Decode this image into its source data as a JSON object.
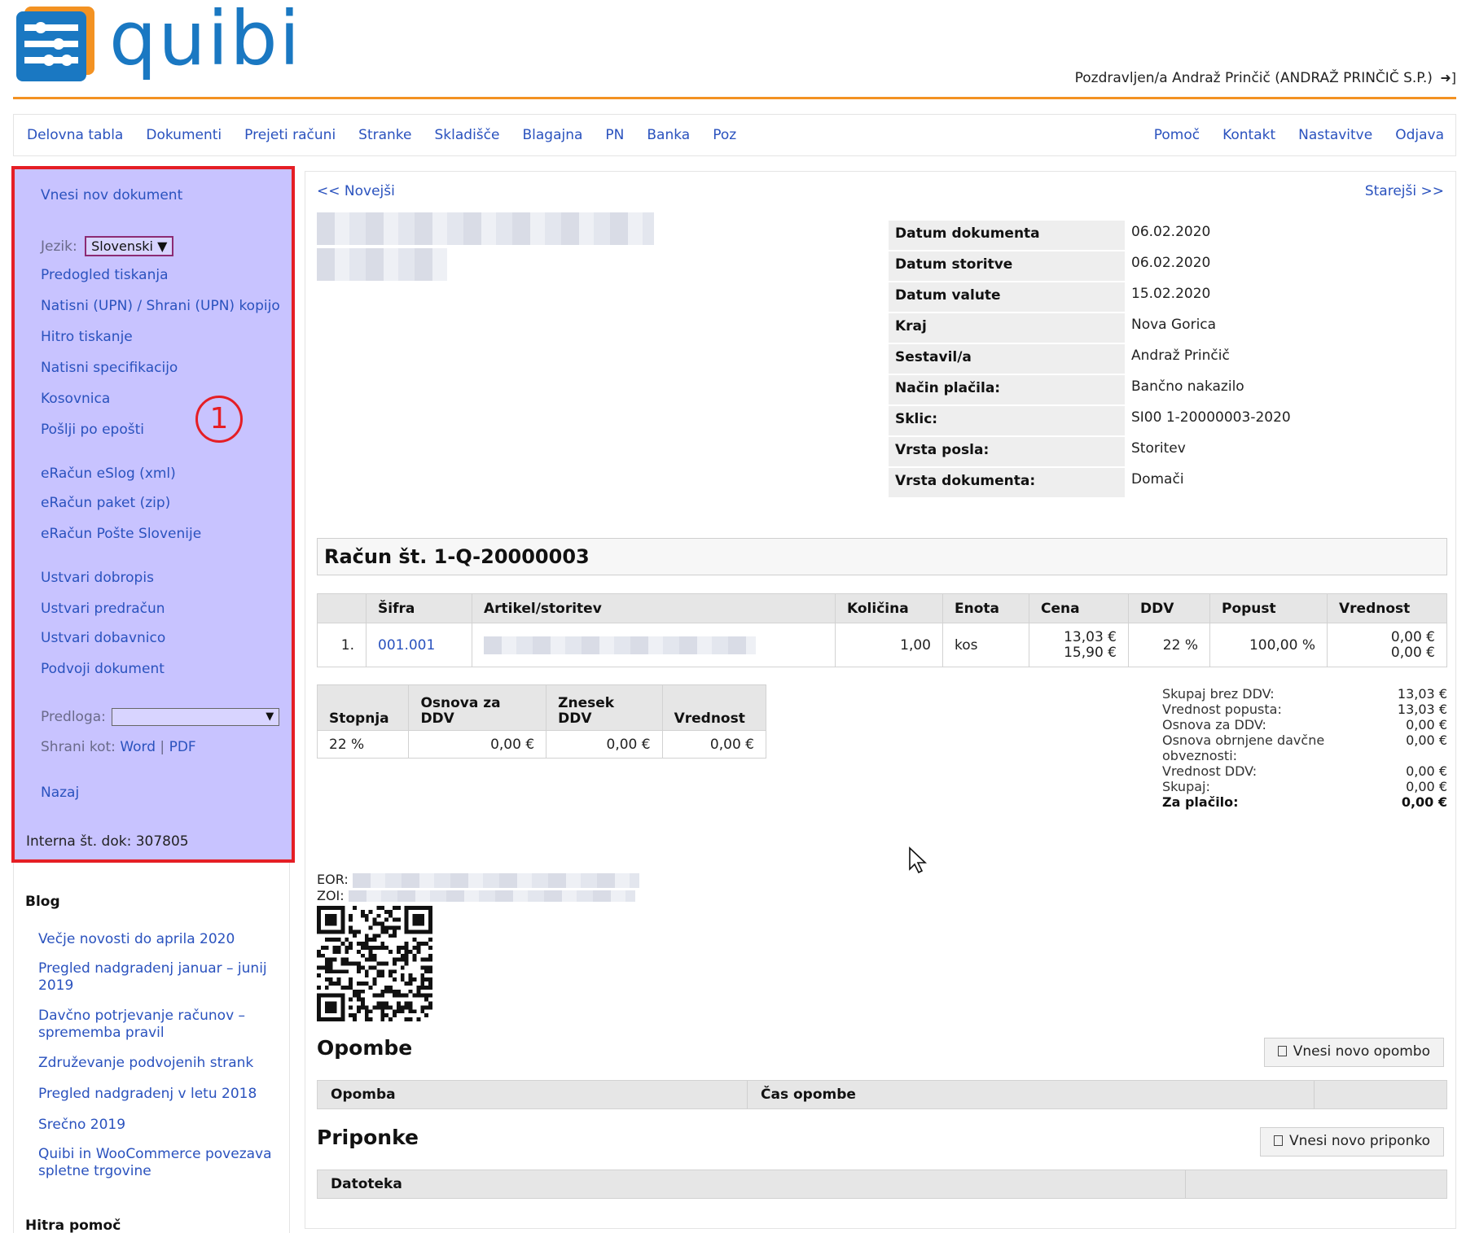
{
  "header": {
    "logo_text": "quibi",
    "greeting": "Pozdravljen/a Andraž Prinčič (ANDRAŽ PRINČIČ S.P.)",
    "logout_icon": "logout-icon"
  },
  "nav": {
    "left": [
      "Delovna tabla",
      "Dokumenti",
      "Prejeti računi",
      "Stranke",
      "Skladišče",
      "Blagajna",
      "PN",
      "Banka",
      "Poz"
    ],
    "right": [
      "Pomoč",
      "Kontakt",
      "Nastavitve",
      "Odjava"
    ]
  },
  "sidebar": {
    "new_document": "Vnesi nov dokument",
    "language_label": "Jezik:",
    "language_value": "Slovenski",
    "print_preview": "Predogled tiskanja",
    "print_upn": "Natisni (UPN) / Shrani (UPN) kopijo",
    "quick_print": "Hitro tiskanje",
    "print_spec": "Natisni specifikacijo",
    "kosovnica": "Kosovnica",
    "send_email": "Pošlji po epošti",
    "eracun_xml": "eRačun eSlog (xml)",
    "eracun_zip": "eRačun paket (zip)",
    "eracun_posta": "eRačun Pošte Slovenije",
    "create_credit": "Ustvari dobropis",
    "create_proforma": "Ustvari predračun",
    "create_delivery": "Ustvari dobavnico",
    "duplicate": "Podvoji dokument",
    "template_label": "Predloga:",
    "save_as_label": "Shrani kot:",
    "save_word": "Word",
    "save_sep": "|",
    "save_pdf": "PDF",
    "back": "Nazaj",
    "internal_no": "Interna št. dok: 307805",
    "badge": "1"
  },
  "blog": {
    "title": "Blog",
    "items": [
      "Večje novosti do aprila 2020",
      "Pregled nadgradenj januar – junij 2019",
      "Davčno potrjevanje računov – sprememba pravil",
      "Združevanje podvojenih strank",
      "Pregled nadgradenj v letu 2018",
      "Srečno 2019",
      "Quibi in WooCommerce povezava spletne trgovine"
    ],
    "help_title": "Hitra pomoč"
  },
  "main": {
    "newer": "<< Novejši",
    "older": "Starejši >>",
    "meta": [
      {
        "k": "Datum dokumenta",
        "v": "06.02.2020"
      },
      {
        "k": "Datum storitve",
        "v": "06.02.2020"
      },
      {
        "k": "Datum valute",
        "v": "15.02.2020"
      },
      {
        "k": "Kraj",
        "v": "Nova Gorica"
      },
      {
        "k": "Sestavil/a",
        "v": "Andraž Prinčič"
      },
      {
        "k": "Način plačila:",
        "v": "Bančno nakazilo"
      },
      {
        "k": "Sklic:",
        "v": "SI00 1-20000003-2020"
      },
      {
        "k": "Vrsta posla:",
        "v": "Storitev"
      },
      {
        "k": "Vrsta dokumenta:",
        "v": "Domači"
      }
    ],
    "doc_title": "Račun št. 1-Q-20000003",
    "items_headers": [
      "",
      "Šifra",
      "Artikel/storitev",
      "Količina",
      "Enota",
      "Cena",
      "DDV",
      "Popust",
      "Vrednost"
    ],
    "items_row": {
      "no": "1.",
      "code": "001.001",
      "qty": "1,00",
      "unit": "kos",
      "price1": "13,03 €",
      "price2": "15,90 €",
      "vat": "22 %",
      "discount": "100,00 %",
      "value1": "0,00 €",
      "value2": "0,00 €"
    },
    "vat_headers": [
      "Stopnja",
      "Osnova za DDV",
      "Znesek DDV",
      "Vrednost"
    ],
    "vat_row": [
      "22 %",
      "0,00 €",
      "0,00 €",
      "0,00 €"
    ],
    "totals": [
      {
        "label": "Skupaj brez DDV:",
        "value": "13,03 €"
      },
      {
        "label": "Vrednost popusta:",
        "value": "13,03 €"
      },
      {
        "label": "Osnova za DDV:",
        "value": "0,00 €"
      },
      {
        "label": "Osnova obrnjene davčne obveznosti:",
        "value": "0,00 €"
      },
      {
        "label": "Vrednost DDV:",
        "value": "0,00 €"
      },
      {
        "label": "Skupaj:",
        "value": "0,00 €"
      },
      {
        "label": "Za plačilo:",
        "value": "0,00 €"
      }
    ],
    "eor_label": "EOR:",
    "zoi_label": "ZOI:",
    "notes_title": "Opombe",
    "notes_button": "Vnesi novo opombo",
    "notes_headers": [
      "Opomba",
      "Čas opombe",
      ""
    ],
    "attach_title": "Priponke",
    "attach_button": "Vnesi novo priponko",
    "attach_headers": [
      "Datoteka",
      ""
    ]
  },
  "colors": {
    "accent_orange": "#f39222",
    "link_blue": "#2a52be",
    "sidebar_bg": "#c8c3ff",
    "highlight_red": "#e51e25",
    "logo_blue": "#1a78c2"
  }
}
